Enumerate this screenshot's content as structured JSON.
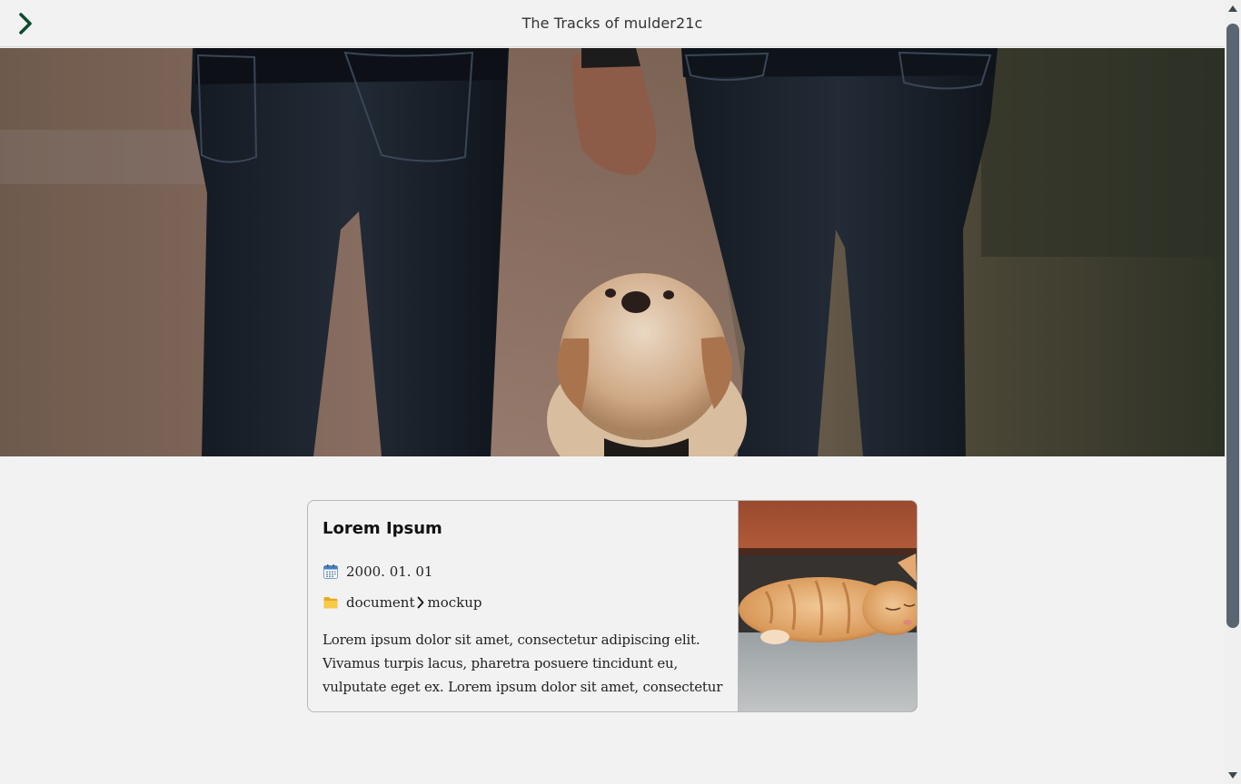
{
  "header": {
    "title": "The Tracks of mulder21c",
    "menu_icon": "chevron-right-icon",
    "accent_color": "#114b2e"
  },
  "hero": {
    "image": "couple-holding-hands-with-puppy-photo"
  },
  "post": {
    "title": "Lorem Ipsum",
    "date": "2000. 01. 01",
    "date_icon": "calendar-icon",
    "category_icon": "folder-icon",
    "category": "document",
    "subcategory": "mockup",
    "excerpt": "Lorem ipsum dolor sit amet, consectetur adipiscing elit. Vivamus turpis lacus, pharetra posuere tincidunt eu, vulputate eget ex. Lorem ipsum dolor sit amet, consectetur adipiscin…",
    "thumbnail": "sleeping-orange-kitten-photo"
  },
  "scrollbar": {
    "thumb_color": "#596570"
  }
}
